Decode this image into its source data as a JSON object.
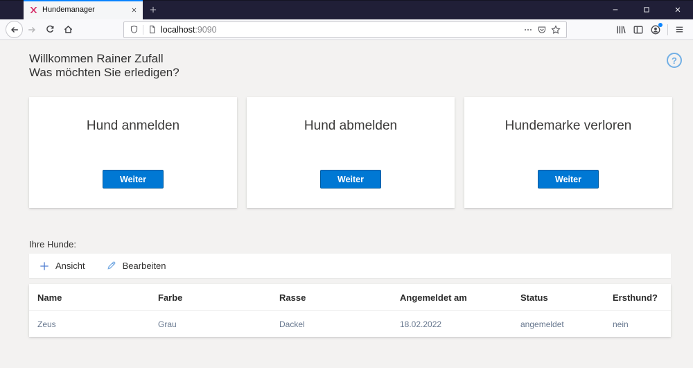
{
  "colors": {
    "accent": "#0078d4",
    "accent_border": "#005a9e",
    "tab_stripe": "#0a84ff",
    "tabbar_bg": "#201f37",
    "page_bg": "#f3f2f1",
    "row_text": "#68788f",
    "help_blue": "#71afe5",
    "favicon_pink": "#d6336c"
  },
  "browser": {
    "tab_title": "Hundemanager",
    "url_host": "localhost",
    "url_port": ":9090",
    "icons": {
      "favicon": "magenta-x-logo",
      "tab_close": "×",
      "new_tab": "+",
      "window_controls": [
        "minimize",
        "maximize",
        "close"
      ],
      "nav": [
        "back-arrow",
        "forward-arrow",
        "reload",
        "home"
      ],
      "urlbar": [
        "shield",
        "document",
        "page-actions-ellipsis",
        "pocket",
        "bookmark-star"
      ],
      "toolbar": [
        "library",
        "sidebar",
        "account",
        "menu-hamburger"
      ]
    }
  },
  "page": {
    "heading_line1": "Willkommen Rainer Zufall",
    "heading_line2": "Was möchten Sie erledigen?",
    "help_glyph": "?",
    "cards": [
      {
        "title": "Hund anmelden",
        "button_label": "Weiter"
      },
      {
        "title": "Hund abmelden",
        "button_label": "Weiter"
      },
      {
        "title": "Hundemarke verloren",
        "button_label": "Weiter"
      }
    ],
    "dogs": {
      "label": "Ihre Hunde:",
      "commands": [
        {
          "icon": "plus-icon",
          "label": "Ansicht"
        },
        {
          "icon": "pencil-icon",
          "label": "Bearbeiten"
        }
      ],
      "table": {
        "headers": [
          "Name",
          "Farbe",
          "Rasse",
          "Angemeldet am",
          "Status",
          "Ersthund?"
        ],
        "rows": [
          [
            "Zeus",
            "Grau",
            "Dackel",
            "18.02.2022",
            "angemeldet",
            "nein"
          ]
        ]
      }
    }
  }
}
